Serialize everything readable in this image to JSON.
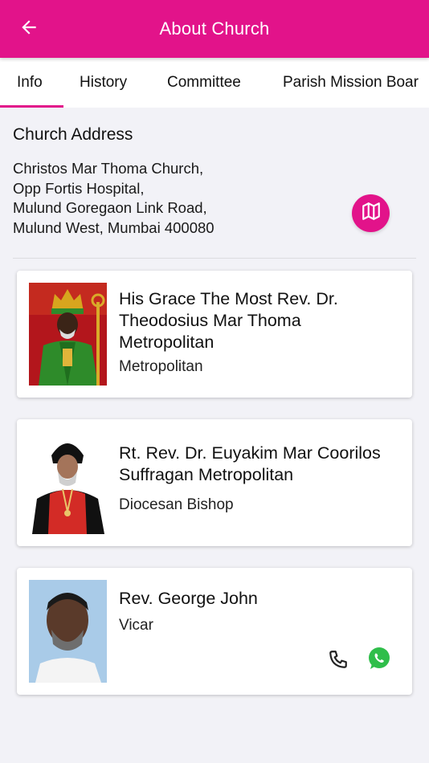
{
  "appbar": {
    "title": "About Church",
    "back_icon": "arrow-left-icon",
    "color": "#e2138a"
  },
  "tabs": [
    {
      "label": "Info",
      "selected": true
    },
    {
      "label": "History",
      "selected": false
    },
    {
      "label": "Committee",
      "selected": false
    },
    {
      "label": "Parish Mission Boar",
      "selected": false
    }
  ],
  "address": {
    "title": "Church Address",
    "lines": [
      "Christos Mar Thoma Church,",
      "Opp Fortis Hospital,",
      "Mulund Goregaon Link Road,",
      "Mulund West, Mumbai 400080"
    ],
    "map_icon": "map-icon"
  },
  "clergy": [
    {
      "name_lines": [
        "His Grace The Most Rev. Dr.",
        "Theodosius Mar Thoma",
        "Metropolitan"
      ],
      "role": "Metropolitan"
    },
    {
      "name_lines": [
        "Rt. Rev. Dr. Euyakim Mar Coorilos",
        "Suffragan Metropolitan"
      ],
      "role": "Diocesan Bishop"
    },
    {
      "name_lines": [
        "Rev. George John"
      ],
      "role": "Vicar",
      "actions": {
        "phone_icon": "phone-icon",
        "whatsapp_icon": "whatsapp-icon"
      }
    }
  ]
}
